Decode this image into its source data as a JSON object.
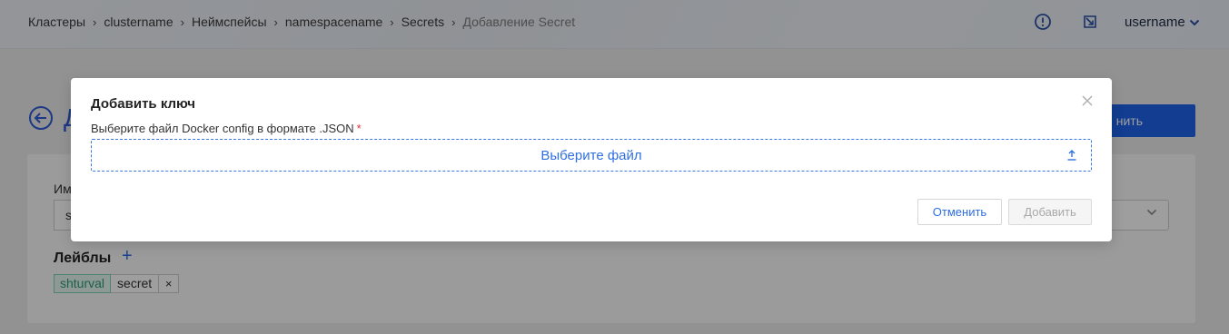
{
  "breadcrumb": [
    {
      "label": "Кластеры"
    },
    {
      "label": "clustername"
    },
    {
      "label": "Неймспейсы"
    },
    {
      "label": "namespacename"
    },
    {
      "label": "Secrets"
    },
    {
      "label": "Добавление Secret"
    }
  ],
  "breadcrumb_separator": "›",
  "header": {
    "icons": [
      "alert-circle-icon",
      "external-link-icon"
    ],
    "username": "username"
  },
  "page": {
    "title_peek": "Д",
    "primary_button_peek": "нить",
    "field_label_peek": "Им",
    "field_value_peek": "s",
    "labels_title": "Лейблы",
    "add_label_glyph": "+",
    "tag": {
      "key": "shturval",
      "value": "secret",
      "remove_glyph": "×"
    }
  },
  "modal": {
    "title": "Добавить ключ",
    "file_label": "Выберите файл Docker config в формате .JSON",
    "required_mark": "*",
    "dropzone_text": "Выберите файл",
    "cancel_label": "Отменить",
    "add_label": "Добавить"
  },
  "colors": {
    "accent": "#2f6fe0",
    "primary_button": "#1e63e8",
    "required": "#e0303a",
    "tag_key_bg": "#e6f7f1",
    "tag_key_text": "#2c9c78"
  }
}
